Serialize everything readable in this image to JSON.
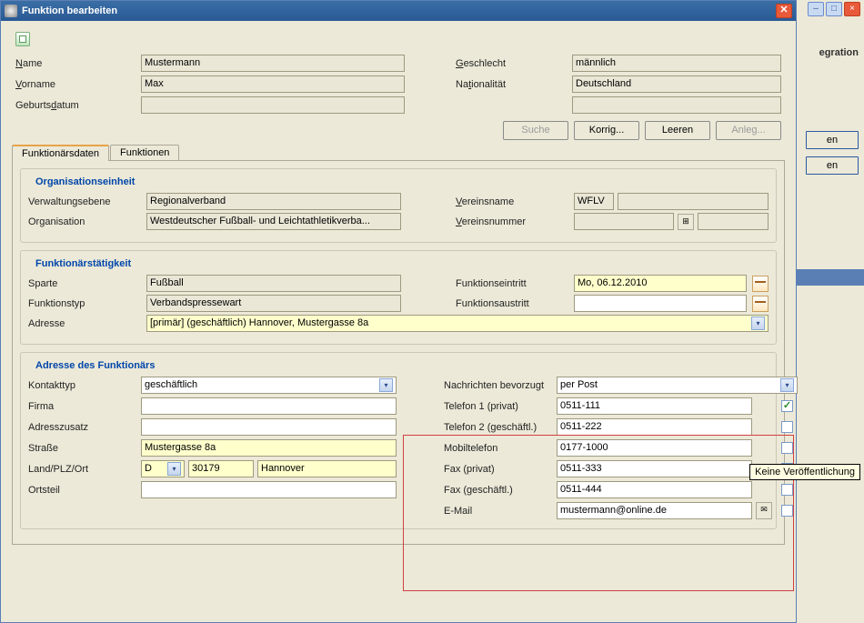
{
  "title": "Funktion bearbeiten",
  "bg": {
    "label": "egration",
    "b1": "en",
    "b2": "en",
    "min": "–",
    "max": "□",
    "close": "×"
  },
  "search": {
    "name_lbl": "Name",
    "name": "Mustermann",
    "vorname_lbl": "Vorname",
    "vorname": "Max",
    "gebdat_lbl": "Geburtsdatum",
    "gebdat": "",
    "geschl_lbl": "Geschlecht",
    "geschl": "männlich",
    "nat_lbl": "Nationalität",
    "nat": "Deutschland",
    "btn_suche": "Suche",
    "btn_korrig": "Korrig...",
    "btn_leeren": "Leeren",
    "btn_anleg": "Anleg..."
  },
  "tabs": {
    "t1": "Funktionärsdaten",
    "t2": "Funktionen"
  },
  "org": {
    "title": "Organisationseinheit",
    "verw_lbl": "Verwaltungsebene",
    "verw": "Regionalverband",
    "orga_lbl": "Organisation",
    "orga": "Westdeutscher Fußball- und Leichtathletikverba...",
    "vname_lbl": "Vereinsname",
    "vname_code": "WFLV",
    "vname": "",
    "vnum_lbl": "Vereinsnummer"
  },
  "taet": {
    "title": "Funktionärstätigkeit",
    "sparte_lbl": "Sparte",
    "sparte": "Fußball",
    "ftyp_lbl": "Funktionstyp",
    "ftyp": "Verbandspressewart",
    "eintritt_lbl": "Funktionseintritt",
    "eintritt": "Mo, 06.12.2010",
    "austritt_lbl": "Funktionsaustritt",
    "austritt": "",
    "addr_lbl": "Adresse",
    "addr": "[primär] (geschäftlich) Hannover, Mustergasse 8a"
  },
  "addr": {
    "title": "Adresse des Funktionärs",
    "kontakt_lbl": "Kontakttyp",
    "kontakt": "geschäftlich",
    "firma_lbl": "Firma",
    "firma": "",
    "zusatz_lbl": "Adresszusatz",
    "zusatz": "",
    "strasse_lbl": "Straße",
    "strasse": "Mustergasse 8a",
    "lpo_lbl": "Land/PLZ/Ort",
    "land": "D",
    "plz": "30179",
    "ort": "Hannover",
    "ortsteil_lbl": "Ortsteil",
    "ortsteil": "",
    "nachrichten_lbl": "Nachrichten bevorzugt",
    "nachrichten": "per Post",
    "tel1_lbl": "Telefon 1 (privat)",
    "tel1": "0511-111",
    "tel1_cb": "✓",
    "tel2_lbl": "Telefon 2 (geschäftl.)",
    "tel2": "0511-222",
    "tel2_cb": "",
    "mobil_lbl": "Mobiltelefon",
    "mobil": "0177-1000",
    "mobil_cb": "",
    "faxp_lbl": "Fax (privat)",
    "faxp": "0511-333",
    "faxp_cb": "✓",
    "faxg_lbl": "Fax (geschäftl.)",
    "faxg": "0511-444",
    "faxg_cb": "",
    "email_lbl": "E-Mail",
    "email": "mustermann@online.de",
    "email_cb": ""
  },
  "tooltip": "Keine Veröffentlichung"
}
